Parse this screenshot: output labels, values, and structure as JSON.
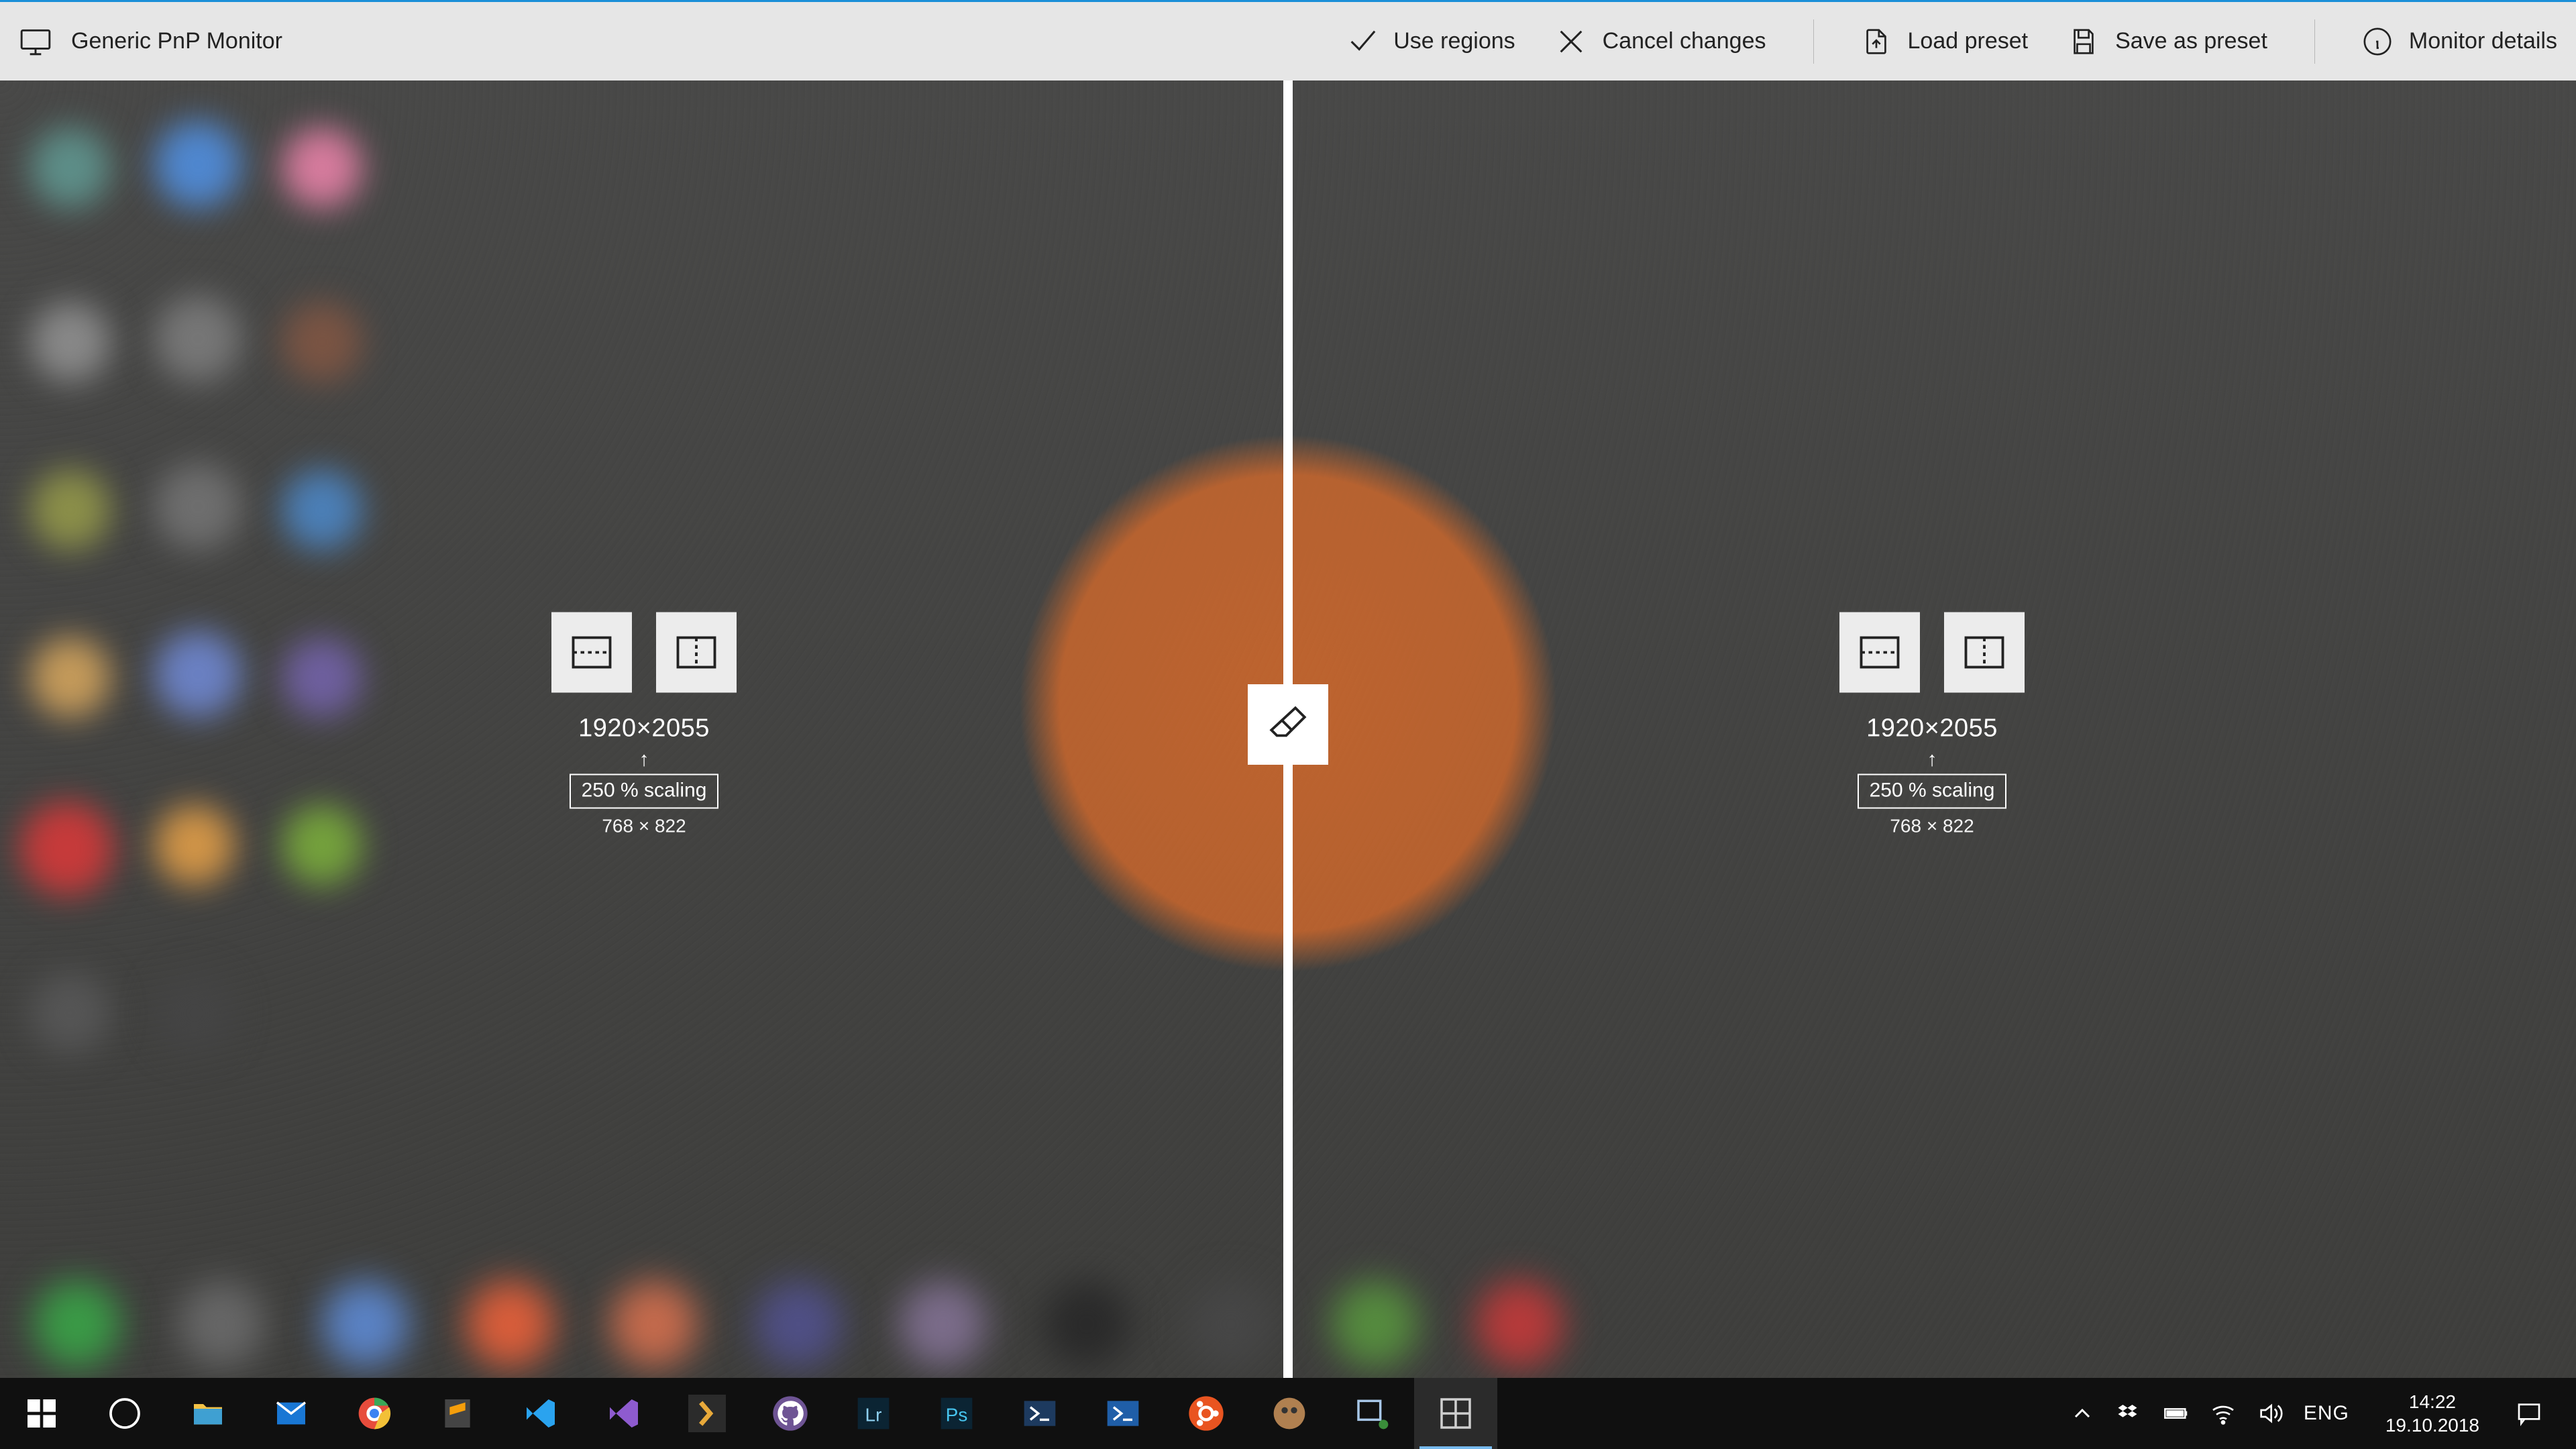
{
  "header": {
    "title": "Generic PnP Monitor",
    "actions": {
      "use_regions": "Use regions",
      "cancel_changes": "Cancel changes",
      "load_preset": "Load preset",
      "save_preset": "Save as preset",
      "monitor_details": "Monitor details"
    }
  },
  "regions": {
    "left": {
      "resolution": "1920×2055",
      "scaling": "250 % scaling",
      "scaled_resolution": "768 × 822"
    },
    "right": {
      "resolution": "1920×2055",
      "scaling": "250 % scaling",
      "scaled_resolution": "768 × 822"
    }
  },
  "tray": {
    "lang": "ENG",
    "time": "14:22",
    "date": "19.10.2018"
  }
}
